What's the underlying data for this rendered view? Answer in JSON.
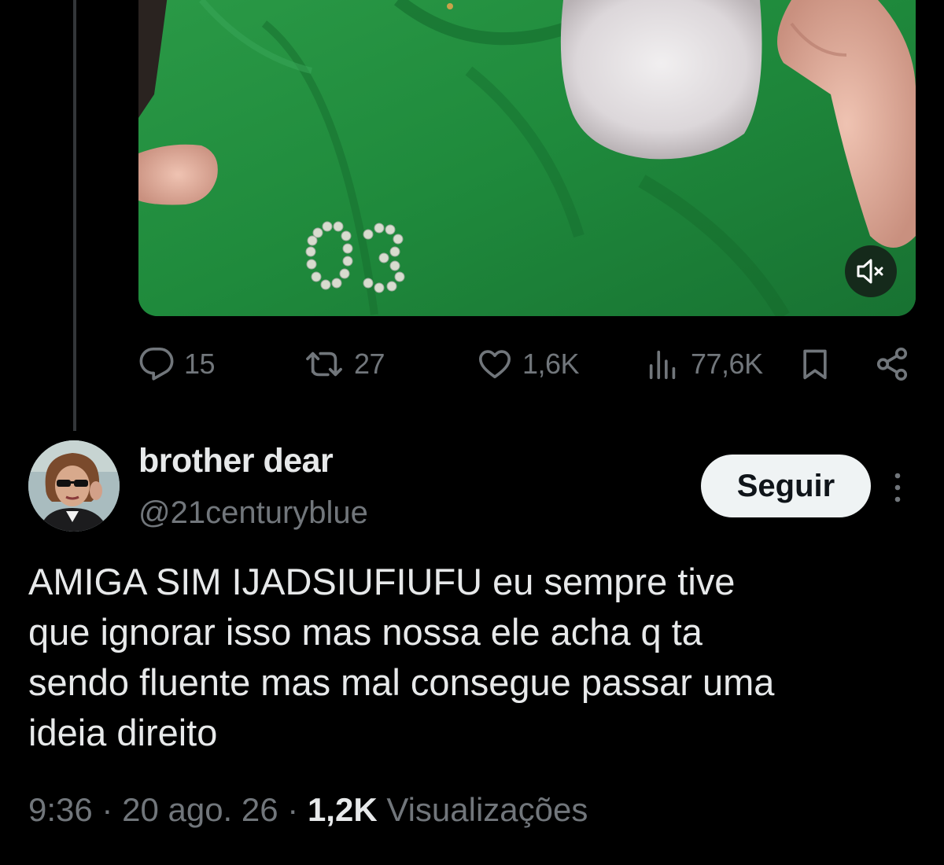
{
  "media": {
    "mute_icon": "volume-mute-icon"
  },
  "actions": {
    "reply": {
      "icon": "reply-icon",
      "count": "15"
    },
    "repost": {
      "icon": "repost-icon",
      "count": "27"
    },
    "like": {
      "icon": "heart-icon",
      "count": "1,6K"
    },
    "views": {
      "icon": "analytics-icon",
      "count": "77,6K"
    },
    "bookmark": {
      "icon": "bookmark-icon"
    },
    "share": {
      "icon": "share-icon"
    }
  },
  "reply": {
    "display_name": "brother dear",
    "handle": "@21centuryblue",
    "follow_label": "Seguir",
    "more_icon": "more-vertical-icon",
    "text": "AMIGA SIM IJADSIUFIUFU eu sempre tive\nque ignorar isso mas nossa ele acha q ta\nsendo fluente mas mal consegue passar uma\nideia direito",
    "time": "9:36",
    "separator": "·",
    "date": "20 ago. 26",
    "views_count": "1,2K",
    "views_label": "Visualizações"
  },
  "colors": {
    "background": "#000000",
    "text_primary": "#e7e9ea",
    "text_secondary": "#71767b",
    "follow_button_bg": "#eff3f4",
    "thread_line": "#333639"
  }
}
